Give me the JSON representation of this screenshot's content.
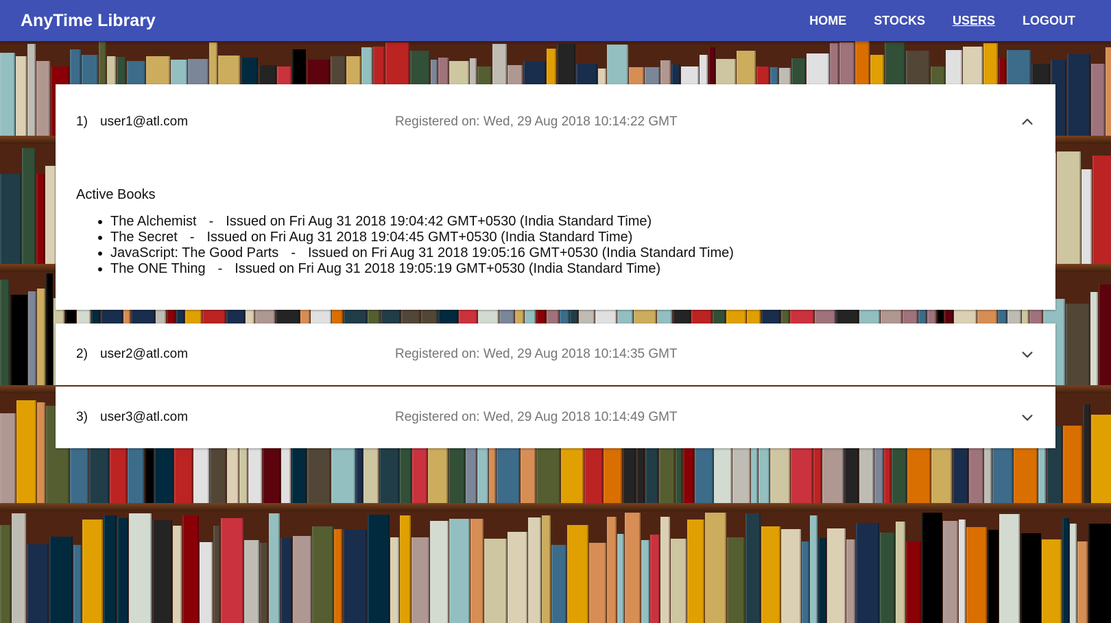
{
  "app": {
    "title": "AnyTime Library",
    "brand_color": "#3f51b5"
  },
  "nav": {
    "items": [
      {
        "label": "HOME",
        "active": false
      },
      {
        "label": "STOCKS",
        "active": false
      },
      {
        "label": "USERS",
        "active": true
      },
      {
        "label": "LOGOUT",
        "active": false
      }
    ]
  },
  "users": [
    {
      "index": "1)",
      "email": "user1@atl.com",
      "registered": "Registered on: Wed, 29 Aug 2018 10:14:22 GMT",
      "expanded": true,
      "chevron_icon": "chevron-up-icon",
      "section_title": "Active Books",
      "separator": "-",
      "books": [
        {
          "title": "The Alchemist",
          "issued": "Issued on Fri Aug 31 2018 19:04:42 GMT+0530 (India Standard Time)"
        },
        {
          "title": "The Secret",
          "issued": "Issued on Fri Aug 31 2018 19:04:45 GMT+0530 (India Standard Time)"
        },
        {
          "title": "JavaScript: The Good Parts",
          "issued": "Issued on Fri Aug 31 2018 19:05:16 GMT+0530 (India Standard Time)"
        },
        {
          "title": "The ONE Thing",
          "issued": "Issued on Fri Aug 31 2018 19:05:19 GMT+0530 (India Standard Time)"
        }
      ]
    },
    {
      "index": "2)",
      "email": "user2@atl.com",
      "registered": "Registered on: Wed, 29 Aug 2018 10:14:35 GMT",
      "expanded": false,
      "chevron_icon": "chevron-down-icon"
    },
    {
      "index": "3)",
      "email": "user3@atl.com",
      "registered": "Registered on: Wed, 29 Aug 2018 10:14:49 GMT",
      "expanded": false,
      "chevron_icon": "chevron-down-icon"
    }
  ]
}
